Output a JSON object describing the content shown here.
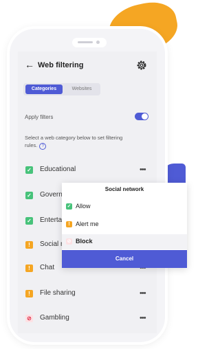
{
  "colors": {
    "accent": "#4f5bd5",
    "allow": "#47c27a",
    "alert": "#f5a623",
    "block": "#e0314b"
  },
  "header": {
    "back_icon": "arrow-left-icon",
    "title": "Web filtering",
    "settings_icon": "gear-icon"
  },
  "tabs": [
    {
      "label": "Categories",
      "selected": true
    },
    {
      "label": "Websites",
      "selected": false
    }
  ],
  "apply_filters": {
    "label": "Apply filters",
    "enabled": true
  },
  "description": "Select a web category below to set filtering rules.",
  "categories": [
    {
      "label": "Educational",
      "status": "allow"
    },
    {
      "label": "Govern",
      "status": "allow"
    },
    {
      "label": "Enterta",
      "status": "allow"
    },
    {
      "label": "Social n",
      "status": "alert"
    },
    {
      "label": "Chat",
      "status": "alert"
    },
    {
      "label": "File sharing",
      "status": "alert"
    },
    {
      "label": "Gambling",
      "status": "block"
    }
  ],
  "popup": {
    "title": "Social network",
    "options": [
      {
        "label": "Allow",
        "icon": "check-icon"
      },
      {
        "label": "Alert me",
        "icon": "exclamation-icon"
      },
      {
        "label": "Block",
        "icon": "block-icon",
        "selected": true
      }
    ],
    "cancel_label": "Cancel"
  },
  "glyphs": {
    "back": "←",
    "more": "•••",
    "check": "✓",
    "alert": "!",
    "block": "⊘",
    "help": "?"
  }
}
